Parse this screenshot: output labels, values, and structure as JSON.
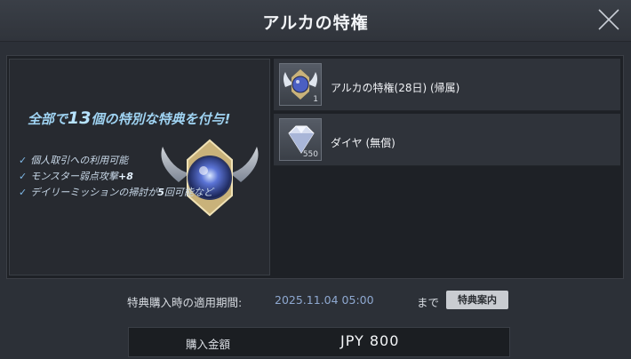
{
  "header": {
    "title": "アルカの特権"
  },
  "promo": {
    "headline_prefix": "全部で",
    "headline_count": "13",
    "headline_suffix": "個の特別な特典を付与!",
    "benefits": [
      {
        "text": "個人取引への利用可能",
        "highlight": ""
      },
      {
        "text": "モンスター弱点攻撃",
        "highlight": "+8"
      },
      {
        "text": "デイリーミッションの掃討が",
        "highlight": "5",
        "tail": "回可能など"
      }
    ]
  },
  "items": [
    {
      "name": "アルカの特権(28日) (帰属)",
      "quantity": "1",
      "icon": "arca-emblem-icon"
    },
    {
      "name": "ダイヤ (無償)",
      "quantity": "550",
      "icon": "diamond-icon"
    }
  ],
  "period": {
    "label": "特典購入時の適用期間:",
    "date": "2025.11.04 05:00",
    "suffix": "まで",
    "guide_button": "特典案内"
  },
  "price": {
    "label": "購入金額",
    "value": "JPY 800"
  },
  "colors": {
    "accent": "#9fd3f2",
    "date": "#8ea8d0",
    "background": "#2c3037"
  }
}
